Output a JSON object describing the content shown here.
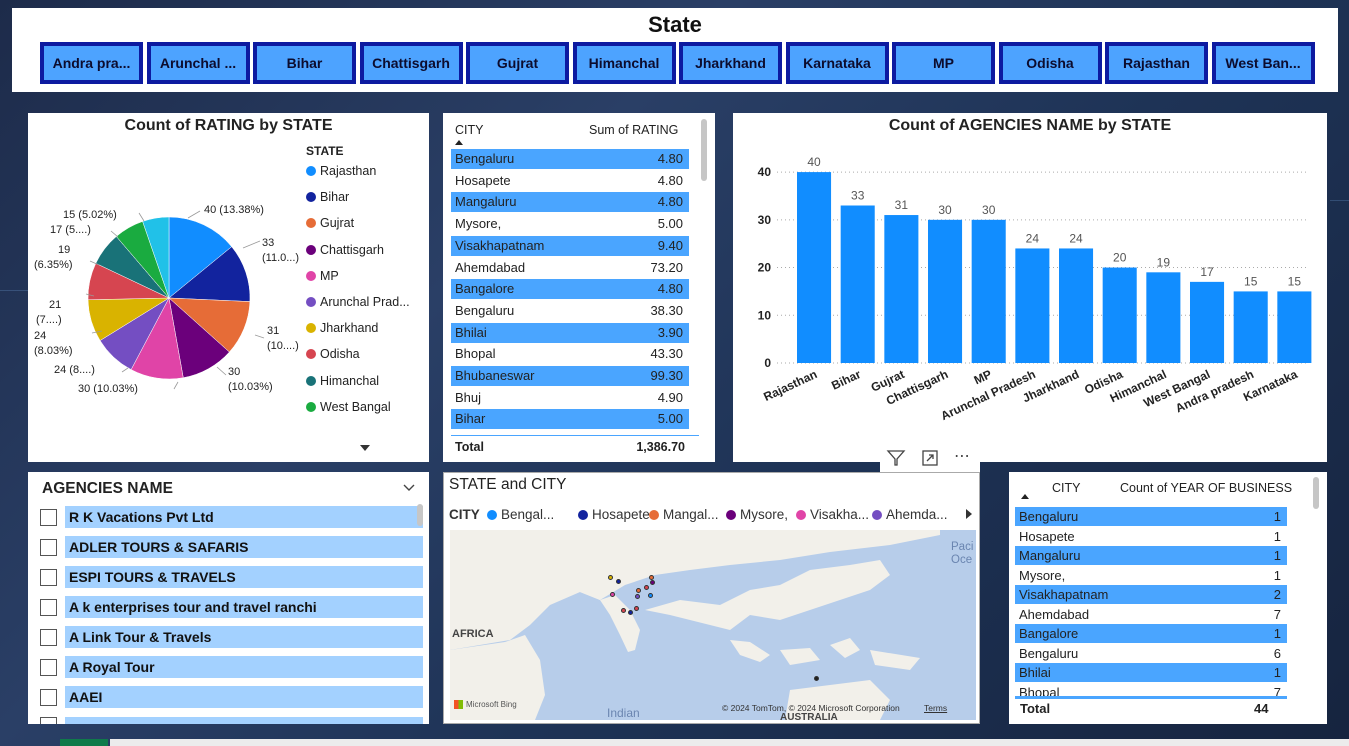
{
  "header": {
    "title": "State",
    "states": [
      "Andra pra...",
      "Arunchal ...",
      "Bihar",
      "Chattisgarh",
      "Gujrat",
      "Himanchal",
      "Jharkhand",
      "Karnataka",
      "MP",
      "Odisha",
      "Rajasthan",
      "West Ban..."
    ]
  },
  "pie": {
    "title": "Count of RATING by STATE",
    "legend_title": "STATE",
    "legend": [
      {
        "name": "Rajasthan",
        "color": "#118DFF"
      },
      {
        "name": "Bihar",
        "color": "#12239E"
      },
      {
        "name": "Gujrat",
        "color": "#E66C37"
      },
      {
        "name": "Chattisgarh",
        "color": "#6B007B"
      },
      {
        "name": "MP",
        "color": "#E044A7"
      },
      {
        "name": "Arunchal Prad...",
        "color": "#744EC2"
      },
      {
        "name": "Jharkhand",
        "color": "#D9B300"
      },
      {
        "name": "Odisha",
        "color": "#D64550"
      },
      {
        "name": "Himanchal",
        "color": "#197278"
      },
      {
        "name": "West Bangal",
        "color": "#1AAB40"
      }
    ],
    "labels": [
      "40 (13.38%)",
      "33",
      "(11.0...)",
      "31",
      "(10....)",
      "30",
      "(10.03%)",
      "30 (10.03%)",
      "24 (8....)",
      "24",
      "(8.03%)",
      "21",
      "(7....)",
      "19",
      "(6.35%)",
      "17 (5....)",
      "15 (5.02%)"
    ]
  },
  "city_table": {
    "col1": "CITY",
    "col2": "Sum of RATING",
    "rows": [
      {
        "city": "Bengaluru",
        "value": "4.80"
      },
      {
        "city": "Hosapete",
        "value": "4.80"
      },
      {
        "city": "Mangaluru",
        "value": "4.80"
      },
      {
        "city": "Mysore,",
        "value": "5.00"
      },
      {
        "city": "Visakhapatnam",
        "value": "9.40"
      },
      {
        "city": "Ahemdabad",
        "value": "73.20"
      },
      {
        "city": "Bangalore",
        "value": "4.80"
      },
      {
        "city": "Bengaluru",
        "value": "38.30"
      },
      {
        "city": "Bhilai",
        "value": "3.90"
      },
      {
        "city": "Bhopal",
        "value": "43.30"
      },
      {
        "city": "Bhubaneswar",
        "value": "99.30"
      },
      {
        "city": "Bhuj",
        "value": "4.90"
      },
      {
        "city": "Bihar",
        "value": "5.00"
      }
    ],
    "total_label": "Total",
    "total_value": "1,386.70"
  },
  "chart_data": {
    "type": "bar",
    "title": "Count of AGENCIES NAME by STATE",
    "categories": [
      "Rajasthan",
      "Bihar",
      "Gujrat",
      "Chattisgarh",
      "MP",
      "Arunchal Pradesh",
      "Jharkhand",
      "Odisha",
      "Himanchal",
      "West Bangal",
      "Andra pradesh",
      "Karnataka"
    ],
    "values": [
      40,
      33,
      31,
      30,
      30,
      24,
      24,
      20,
      19,
      17,
      15,
      15
    ],
    "yticks": [
      0,
      10,
      20,
      30,
      40
    ],
    "ylim": [
      0,
      44
    ],
    "color": "#118DFF",
    "grid": true
  },
  "agencies": {
    "title": "AGENCIES NAME",
    "items": [
      "R K Vacations Pvt Ltd",
      "ADLER TOURS & SAFARIS",
      "ESPI TOURS & TRAVELS",
      "A k enterprises tour and travel ranchi",
      "A Link Tour & Travels",
      "A Royal Tour",
      "AAEI"
    ]
  },
  "map": {
    "title": "STATE and CITY",
    "legend_label": "CITY",
    "legend": [
      {
        "name": "Bengal...",
        "color": "#118DFF"
      },
      {
        "name": "Hosapete",
        "color": "#12239E"
      },
      {
        "name": "Mangal...",
        "color": "#E66C37"
      },
      {
        "name": "Mysore,",
        "color": "#6B007B"
      },
      {
        "name": "Visakha...",
        "color": "#E044A7"
      },
      {
        "name": "Ahemda...",
        "color": "#744EC2"
      }
    ],
    "africa": "AFRICA",
    "pacific1": "Paci",
    "pacific2": "Oce",
    "indian": "Indian",
    "australia": "AUSTRALIA",
    "bing": "Microsoft Bing",
    "copyright": "© 2024 TomTom, © 2024 Microsoft Corporation",
    "terms": "Terms"
  },
  "year_table": {
    "col1": "CITY",
    "col2": "Count of YEAR OF BUSINESS",
    "rows": [
      {
        "city": "Bengaluru",
        "value": "1"
      },
      {
        "city": "Hosapete",
        "value": "1"
      },
      {
        "city": "Mangaluru",
        "value": "1"
      },
      {
        "city": "Mysore,",
        "value": "1"
      },
      {
        "city": "Visakhapatnam",
        "value": "2"
      },
      {
        "city": "Ahemdabad",
        "value": "7"
      },
      {
        "city": "Bangalore",
        "value": "1"
      },
      {
        "city": "Bengaluru",
        "value": "6"
      },
      {
        "city": "Bhilai",
        "value": "1"
      },
      {
        "city": "Bhopal",
        "value": "7"
      }
    ],
    "total_label": "Total",
    "total_value": "44"
  },
  "icons": {
    "filter": "filter-icon",
    "focus": "focus-mode-icon",
    "more": "more-options-icon"
  }
}
